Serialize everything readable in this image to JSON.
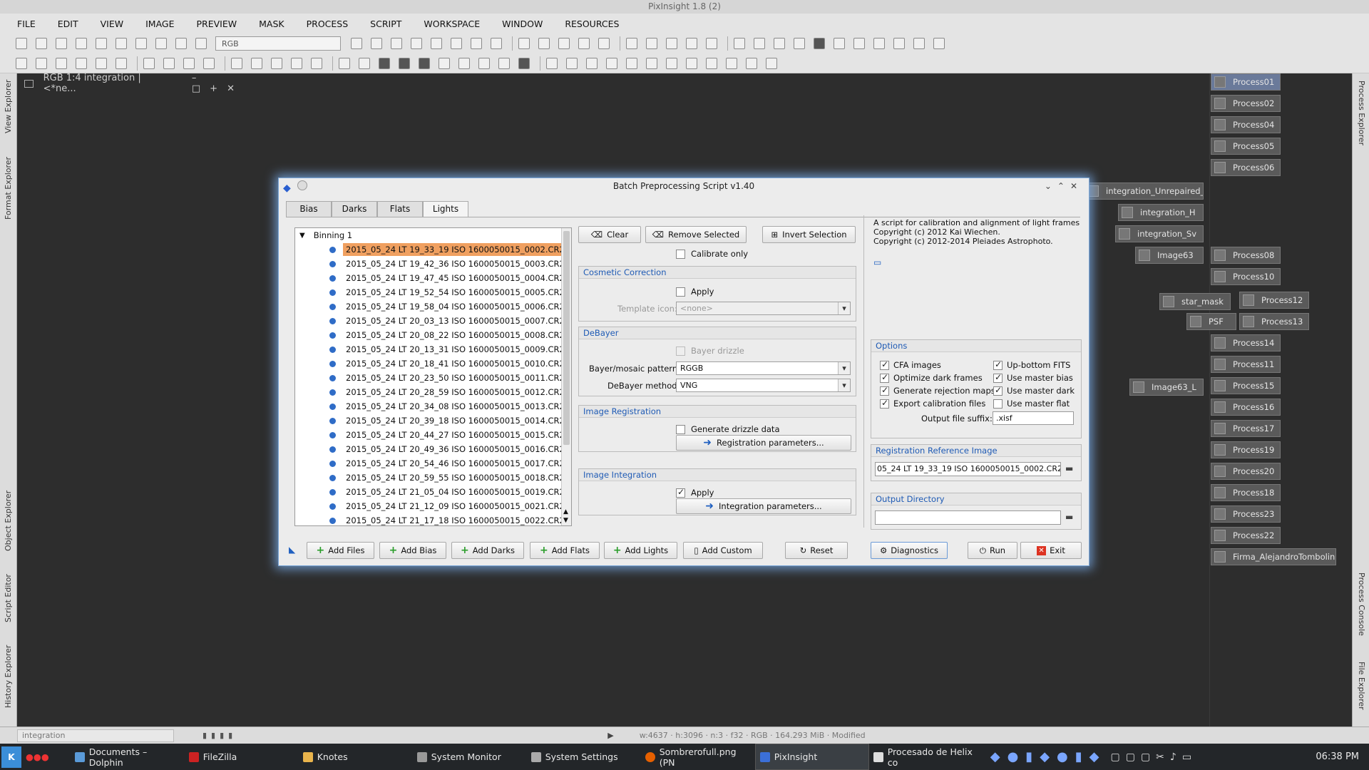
{
  "app": {
    "title": "PixInsight 1.8 (2)"
  },
  "menu": [
    "FILE",
    "EDIT",
    "VIEW",
    "IMAGE",
    "PREVIEW",
    "MASK",
    "PROCESS",
    "SCRIPT",
    "WORKSPACE",
    "WINDOW",
    "RESOURCES"
  ],
  "toolbar": {
    "color_space": "RGB"
  },
  "left_dock": [
    "View Explorer",
    "Format Explorer",
    "Object Explorer",
    "Script Editor",
    "History Explorer"
  ],
  "right_dock": [
    "Process Explorer",
    "Process Console",
    "File Explorer"
  ],
  "image_window": {
    "title": "RGB 1:4 integration | <*ne..."
  },
  "icons_right": [
    "Process01",
    "Process02",
    "Process04",
    "Process05",
    "Process06",
    "Process08",
    "Process10",
    "Process12",
    "Process13",
    "Process14",
    "Process11",
    "Process15",
    "Process16",
    "Process17",
    "Process19",
    "Process20",
    "Process18",
    "Process23",
    "Process22",
    "Firma_AlejandroTombolini"
  ],
  "icons_floating": [
    "integration_Unrepaired_V",
    "integration_H",
    "integration_Sv",
    "Image63",
    "star_mask",
    "PSF",
    "Image63_L"
  ],
  "dialog": {
    "title": "Batch Preprocessing Script v1.40",
    "tabs": [
      "Bias",
      "Darks",
      "Flats",
      "Lights"
    ],
    "active_tab": "Lights",
    "group": "Binning 1",
    "files": [
      "2015_05_24 LT 19_33_19 ISO 1600050015_0002.CR2",
      "2015_05_24 LT 19_42_36 ISO 1600050015_0003.CR2",
      "2015_05_24 LT 19_47_45 ISO 1600050015_0004.CR2",
      "2015_05_24 LT 19_52_54 ISO 1600050015_0005.CR2",
      "2015_05_24 LT 19_58_04 ISO 1600050015_0006.CR2",
      "2015_05_24 LT 20_03_13 ISO 1600050015_0007.CR2",
      "2015_05_24 LT 20_08_22 ISO 1600050015_0008.CR2",
      "2015_05_24 LT 20_13_31 ISO 1600050015_0009.CR2",
      "2015_05_24 LT 20_18_41 ISO 1600050015_0010.CR2",
      "2015_05_24 LT 20_23_50 ISO 1600050015_0011.CR2",
      "2015_05_24 LT 20_28_59 ISO 1600050015_0012.CR2",
      "2015_05_24 LT 20_34_08 ISO 1600050015_0013.CR2",
      "2015_05_24 LT 20_39_18 ISO 1600050015_0014.CR2",
      "2015_05_24 LT 20_44_27 ISO 1600050015_0015.CR2",
      "2015_05_24 LT 20_49_36 ISO 1600050015_0016.CR2",
      "2015_05_24 LT 20_54_46 ISO 1600050015_0017.CR2",
      "2015_05_24 LT 20_59_55 ISO 1600050015_0018.CR2",
      "2015_05_24 LT 21_05_04 ISO 1600050015_0019.CR2",
      "2015_05_24 LT 21_12_09 ISO 1600050015_0021.CR2",
      "2015_05_24 LT 21_17_18 ISO 1600050015_0022.CR2"
    ],
    "clear": "Clear",
    "remove_selected": "Remove Selected",
    "invert_selection": "Invert Selection",
    "calibrate_only": "Calibrate only",
    "cosmetic": {
      "title": "Cosmetic Correction",
      "apply": "Apply",
      "template_label": "Template icon:",
      "template_value": "<none>"
    },
    "debayer": {
      "title": "DeBayer",
      "drizzle": "Bayer drizzle",
      "pattern_label": "Bayer/mosaic pattern:",
      "pattern": "RGGB",
      "method_label": "DeBayer method:",
      "method": "VNG"
    },
    "registration": {
      "title": "Image Registration",
      "drizzle_data": "Generate drizzle data",
      "params": "Registration parameters..."
    },
    "integration": {
      "title": "Image Integration",
      "apply": "Apply",
      "params": "Integration parameters..."
    },
    "info": "A script for calibration and alignment of light frames\nCopyright (c) 2012 Kai Wiechen.\nCopyright (c) 2012-2014 Pleiades Astrophoto.",
    "options": {
      "title": "Options",
      "cfa": "CFA images",
      "optimize": "Optimize dark frames",
      "rejection": "Generate rejection maps",
      "export": "Export calibration files",
      "upbottom": "Up-bottom FITS",
      "master_bias": "Use master bias",
      "master_dark": "Use master dark",
      "master_flat": "Use master flat",
      "suffix_label": "Output file suffix:",
      "suffix": ".xisf"
    },
    "reference": {
      "title": "Registration Reference Image",
      "value": "05_24 LT 19_33_19 ISO 1600050015_0002.CR2"
    },
    "output": {
      "title": "Output Directory",
      "value": ""
    },
    "buttons": {
      "add_files": "Add Files",
      "add_bias": "Add Bias",
      "add_darks": "Add Darks",
      "add_flats": "Add Flats",
      "add_lights": "Add Lights",
      "add_custom": "Add Custom",
      "reset": "Reset",
      "diagnostics": "Diagnostics",
      "run": "Run",
      "exit": "Exit"
    }
  },
  "statusbar": {
    "view": "integration",
    "info": "w:4637 · h:3096 · n:3 · f32 · RGB · 164.293 MiB · Modified"
  },
  "taskbar": {
    "items": [
      "Documents – Dolphin",
      "FileZilla",
      "Knotes",
      "System Monitor",
      "System Settings",
      "Sombrerofull.png (PN",
      "PixInsight",
      "Procesado de Helix co"
    ],
    "clock": "06:38 PM"
  }
}
